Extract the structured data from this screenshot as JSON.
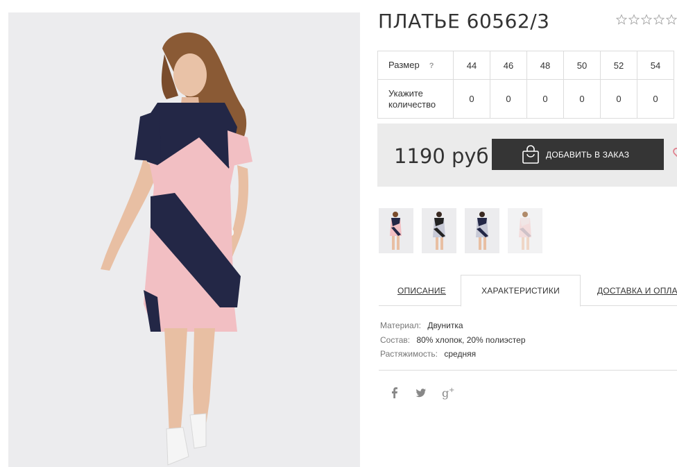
{
  "product": {
    "title": "ПЛАТЬЕ 60562/3",
    "rating_stars": 5,
    "rating_value": 0
  },
  "sizes": {
    "size_label": "Размер",
    "help_label": "?",
    "qty_label_1": "Укажите",
    "qty_label_2": "количество",
    "items": [
      {
        "size": "44",
        "qty": "0"
      },
      {
        "size": "46",
        "qty": "0"
      },
      {
        "size": "48",
        "qty": "0"
      },
      {
        "size": "50",
        "qty": "0"
      },
      {
        "size": "52",
        "qty": "0"
      },
      {
        "size": "54",
        "qty": "0"
      }
    ]
  },
  "order": {
    "price": "1190 руб",
    "add_label": "ДОБАВИТЬ В ЗАКАЗ"
  },
  "tabs": {
    "description": "ОПИСАНИЕ",
    "characteristics": "ХАРАКТЕРИСТИКИ",
    "delivery": "ДОСТАВКА И ОПЛАТА"
  },
  "characteristics": [
    {
      "key": "Материал:",
      "value": "Двунитка"
    },
    {
      "key": "Состав:",
      "value": "80% хлопок, 20% полиэстер"
    },
    {
      "key": "Растяжимость:",
      "value": "средняя"
    }
  ],
  "colors": {
    "navy": "#232746",
    "pink": "#f2bfc3",
    "button": "#353535",
    "heart": "#e0828f",
    "price_bg": "#ebebeb"
  },
  "icons": {
    "bag": "shopping-bag-icon",
    "heart": "heart-icon",
    "facebook": "facebook-icon",
    "twitter": "twitter-icon",
    "googleplus": "google-plus-icon",
    "star": "star-icon"
  }
}
